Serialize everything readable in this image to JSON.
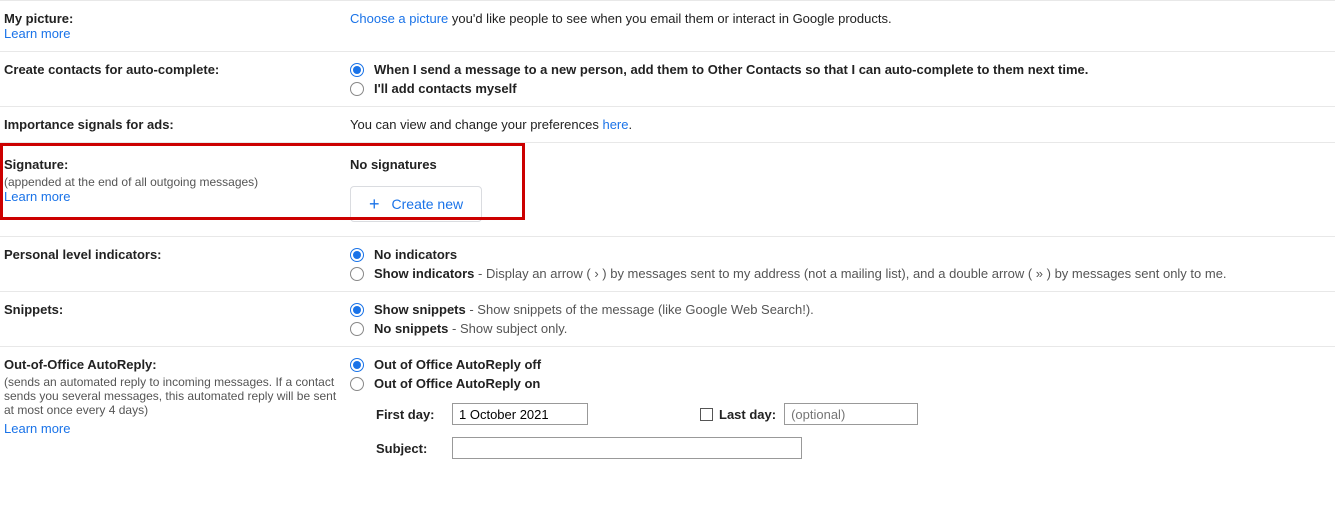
{
  "picture": {
    "label": "My picture:",
    "learn": "Learn more",
    "choose": "Choose a picture",
    "rest": " you'd like people to see when you email them or interact in Google products."
  },
  "contacts": {
    "label": "Create contacts for auto-complete:",
    "opt1": "When I send a message to a new person, add them to Other Contacts so that I can auto-complete to them next time.",
    "opt2": "I'll add contacts myself"
  },
  "ads": {
    "label": "Importance signals for ads:",
    "pre": "You can view and change your preferences ",
    "link": "here",
    "post": "."
  },
  "signature": {
    "label": "Signature:",
    "sub": "(appended at the end of all outgoing messages)",
    "learn": "Learn more",
    "none": "No signatures",
    "create": "Create new"
  },
  "indicators": {
    "label": "Personal level indicators:",
    "opt1": "No indicators",
    "opt2b": "Show indicators",
    "opt2r": " - Display an arrow ( › ) by messages sent to my address (not a mailing list), and a double arrow ( » ) by messages sent only to me."
  },
  "snippets": {
    "label": "Snippets:",
    "opt1b": "Show snippets",
    "opt1r": " - Show snippets of the message (like Google Web Search!).",
    "opt2b": "No snippets",
    "opt2r": " - Show subject only."
  },
  "ooo": {
    "label": "Out-of-Office AutoReply:",
    "sub": "(sends an automated reply to incoming messages. If a contact sends you several messages, this automated reply will be sent at most once every 4 days)",
    "learn": "Learn more",
    "opt1": "Out of Office AutoReply off",
    "opt2": "Out of Office AutoReply on",
    "firstday_label": "First day:",
    "firstday_value": "1 October 2021",
    "lastday_label": "Last day:",
    "lastday_placeholder": "(optional)",
    "subject_label": "Subject:"
  }
}
